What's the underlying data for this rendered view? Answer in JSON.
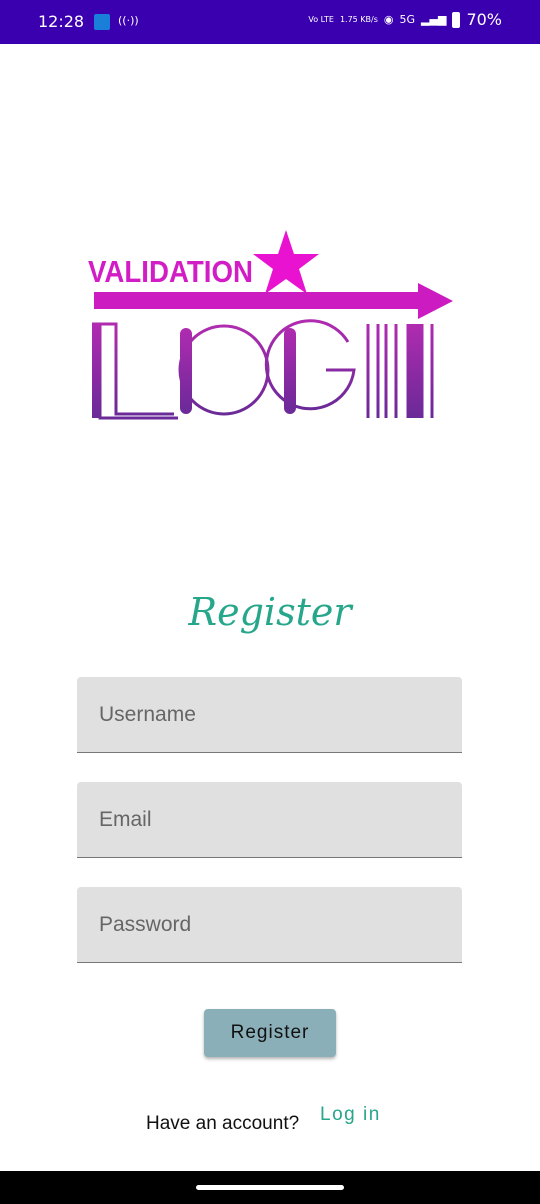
{
  "status_bar": {
    "time": "12:28",
    "hotspot": "((·))",
    "volte": "Vo LTE",
    "speed": "1.75 KB/s",
    "network": "5G",
    "battery": "70%"
  },
  "logo": {
    "top_text": "VALIDATION",
    "main_text": "LOGIN"
  },
  "form": {
    "title": "Register",
    "username_placeholder": "Username",
    "email_placeholder": "Email",
    "password_placeholder": "Password",
    "submit_label": "Register"
  },
  "footer": {
    "prompt": "Have an account?",
    "login_link": "Log in"
  }
}
